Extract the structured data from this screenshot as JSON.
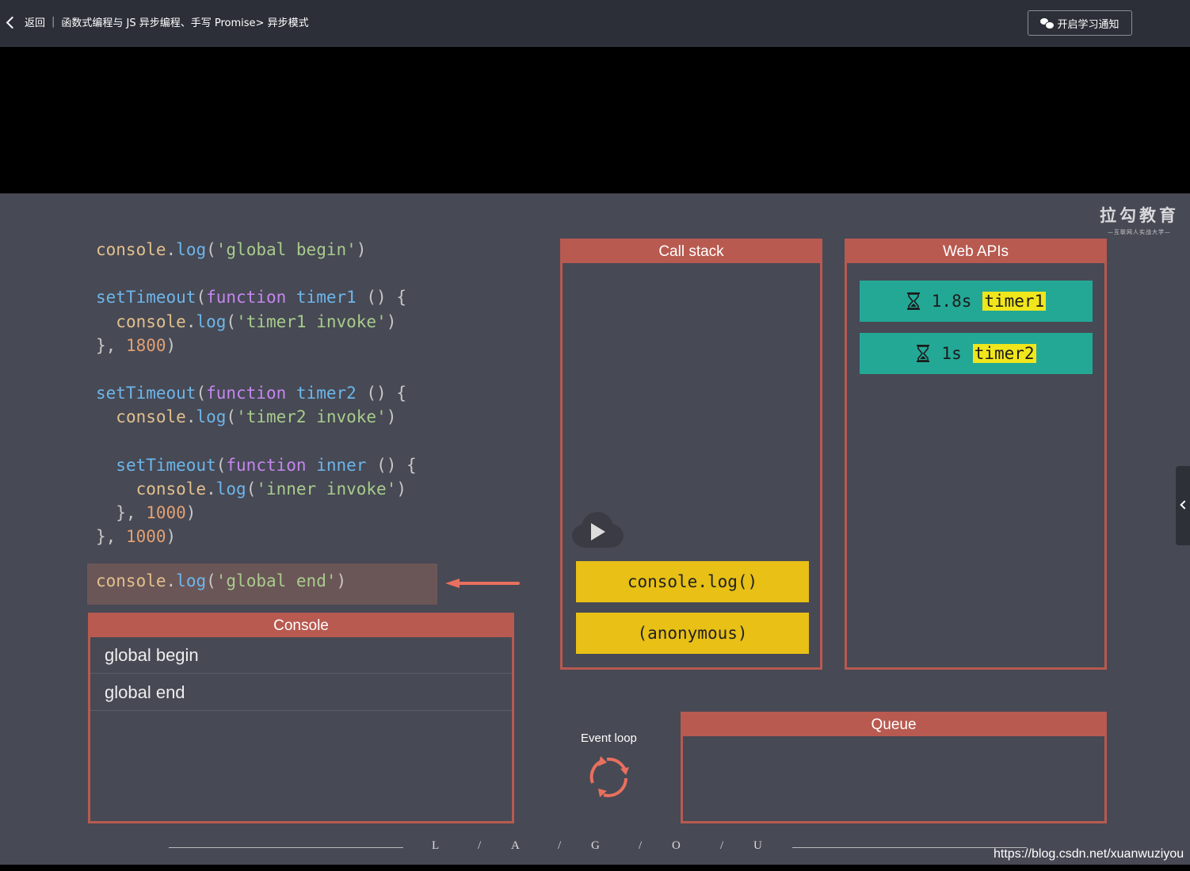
{
  "topbar": {
    "back_label": "返回",
    "separator": "|",
    "breadcrumb": "函数式编程与 JS 异步编程、手写 Promise> 异步模式",
    "notify_button": "开启学习通知"
  },
  "slide": {
    "logo_main": "拉勾教育",
    "logo_sub": "—互联网人实战大学—",
    "code_lines": [
      [
        [
          "console",
          "c-obj"
        ],
        [
          ".",
          "c-p"
        ],
        [
          "log",
          "c-fn"
        ],
        [
          "(",
          "c-p"
        ],
        [
          "'global begin'",
          "c-str"
        ],
        [
          ")",
          "c-p"
        ]
      ],
      [],
      [
        [
          "setTimeout",
          "c-fn"
        ],
        [
          "(",
          "c-p"
        ],
        [
          "function",
          "c-kw"
        ],
        [
          " ",
          "c-p"
        ],
        [
          "timer1",
          "c-fn"
        ],
        [
          " () {",
          "c-p"
        ]
      ],
      [
        [
          "  ",
          "c-p"
        ],
        [
          "console",
          "c-obj"
        ],
        [
          ".",
          "c-p"
        ],
        [
          "log",
          "c-fn"
        ],
        [
          "(",
          "c-p"
        ],
        [
          "'timer1 invoke'",
          "c-str"
        ],
        [
          ")",
          "c-p"
        ]
      ],
      [
        [
          "}, ",
          "c-p"
        ],
        [
          "1800",
          "c-num"
        ],
        [
          ")",
          "c-p"
        ]
      ],
      [],
      [
        [
          "setTimeout",
          "c-fn"
        ],
        [
          "(",
          "c-p"
        ],
        [
          "function",
          "c-kw"
        ],
        [
          " ",
          "c-p"
        ],
        [
          "timer2",
          "c-fn"
        ],
        [
          " () {",
          "c-p"
        ]
      ],
      [
        [
          "  ",
          "c-p"
        ],
        [
          "console",
          "c-obj"
        ],
        [
          ".",
          "c-p"
        ],
        [
          "log",
          "c-fn"
        ],
        [
          "(",
          "c-p"
        ],
        [
          "'timer2 invoke'",
          "c-str"
        ],
        [
          ")",
          "c-p"
        ]
      ],
      [],
      [
        [
          "  ",
          "c-p"
        ],
        [
          "setTimeout",
          "c-fn"
        ],
        [
          "(",
          "c-p"
        ],
        [
          "function",
          "c-kw"
        ],
        [
          " ",
          "c-p"
        ],
        [
          "inner",
          "c-fn"
        ],
        [
          " () {",
          "c-p"
        ]
      ],
      [
        [
          "    ",
          "c-p"
        ],
        [
          "console",
          "c-obj"
        ],
        [
          ".",
          "c-p"
        ],
        [
          "log",
          "c-fn"
        ],
        [
          "(",
          "c-p"
        ],
        [
          "'inner invoke'",
          "c-str"
        ],
        [
          ")",
          "c-p"
        ]
      ],
      [
        [
          "  }, ",
          "c-p"
        ],
        [
          "1000",
          "c-num"
        ],
        [
          ")",
          "c-p"
        ]
      ],
      [
        [
          "}, ",
          "c-p"
        ],
        [
          "1000",
          "c-num"
        ],
        [
          ")",
          "c-p"
        ]
      ]
    ],
    "highlight_line": [
      [
        "console",
        "c-obj"
      ],
      [
        ".",
        "c-p"
      ],
      [
        "log",
        "c-fn"
      ],
      [
        "(",
        "c-p"
      ],
      [
        "'global end'",
        "c-str"
      ],
      [
        ")",
        "c-p"
      ]
    ],
    "console": {
      "title": "Console",
      "rows": [
        "global begin",
        "global end"
      ]
    },
    "call_stack": {
      "title": "Call stack",
      "frames": [
        "console.log()",
        "(anonymous)"
      ]
    },
    "web_apis": {
      "title": "Web APIs",
      "timers": [
        {
          "delay": "1.8s",
          "name": "timer1"
        },
        {
          "delay": "1s",
          "name": "timer2"
        }
      ]
    },
    "queue": {
      "title": "Queue"
    },
    "event_loop_label": "Event loop",
    "footer_letters": [
      "L",
      "/",
      "A",
      "/",
      "G",
      "/",
      "O",
      "/",
      "U"
    ],
    "accent_color": "#b85a50",
    "frame_color": "#e8c016",
    "timer_color": "#23a896"
  },
  "watermark": "https://blog.csdn.net/xuanwuziyou"
}
